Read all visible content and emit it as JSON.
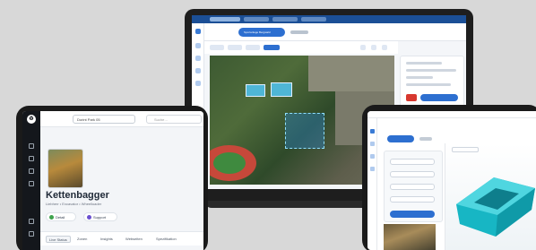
{
  "tablet_left": {
    "logo": "♻",
    "select_value": "Dorint Park 05",
    "search_placeholder": "Suche…",
    "title": "Kettenbagger",
    "subtitle": "Liebherr • Excavator • Wheelloader",
    "pills": [
      {
        "label": "Detail",
        "color": "#3fa34d"
      },
      {
        "label": "Support",
        "color": "#6a4fd0"
      }
    ],
    "tabs": [
      "Live Status",
      "Zonen",
      "Insights",
      "Webseiten",
      "Spezifikation"
    ]
  },
  "laptop": {
    "chip_label": "Sportanlage Bergwald",
    "colors": {
      "brand": "#1b4f96",
      "accent": "#2d6fd0",
      "danger": "#d7382f"
    }
  },
  "tablet_right": {
    "colors": {
      "accent": "#2d6fd0",
      "model": "#17b6c4"
    }
  }
}
